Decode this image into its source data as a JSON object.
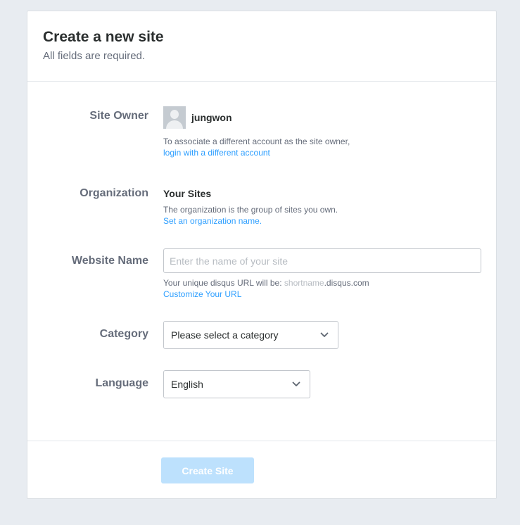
{
  "header": {
    "title": "Create a new site",
    "subtitle": "All fields are required."
  },
  "site_owner": {
    "label": "Site Owner",
    "username": "jungwon",
    "help": "To associate a different account as the site owner,",
    "link": "login with a different account"
  },
  "organization": {
    "label": "Organization",
    "value": "Your Sites",
    "help": "The organization is the group of sites you own.",
    "link": "Set an organization name."
  },
  "website_name": {
    "label": "Website Name",
    "placeholder": "Enter the name of your site",
    "value": "",
    "url_prefix": "Your unique disqus URL will be: ",
    "url_shortname": "shortname",
    "url_suffix": ".disqus.com",
    "link": "Customize Your URL"
  },
  "category": {
    "label": "Category",
    "selected": "Please select a category"
  },
  "language": {
    "label": "Language",
    "selected": "English"
  },
  "footer": {
    "submit_label": "Create Site"
  },
  "colors": {
    "background": "#e8ecf1",
    "link": "#2e9fff",
    "button_disabled": "#bde1fd"
  },
  "icons": [
    "avatar-placeholder-icon",
    "chevron-down-icon"
  ]
}
